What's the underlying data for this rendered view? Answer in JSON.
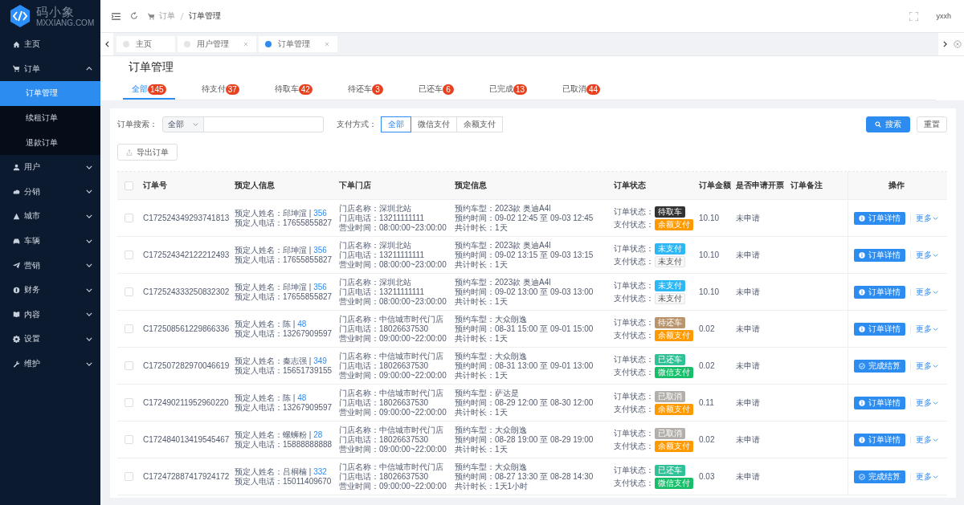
{
  "logo": {
    "name": "码小象",
    "domain": "MXXIANG.COM"
  },
  "sidebar": {
    "items": [
      {
        "label": "主页",
        "kind": "link"
      },
      {
        "label": "订单",
        "kind": "group",
        "expanded": true,
        "children": [
          {
            "label": "订单管理",
            "selected": true
          },
          {
            "label": "续租订单",
            "selected": false
          },
          {
            "label": "退款订单",
            "selected": false
          }
        ]
      },
      {
        "label": "用户",
        "kind": "group",
        "expanded": false
      },
      {
        "label": "分销",
        "kind": "group",
        "expanded": false
      },
      {
        "label": "城市",
        "kind": "group",
        "expanded": false
      },
      {
        "label": "车辆",
        "kind": "group",
        "expanded": false
      },
      {
        "label": "营销",
        "kind": "group",
        "expanded": false
      },
      {
        "label": "财务",
        "kind": "group",
        "expanded": false
      },
      {
        "label": "内容",
        "kind": "group",
        "expanded": false
      },
      {
        "label": "设置",
        "kind": "group",
        "expanded": false
      },
      {
        "label": "维护",
        "kind": "group",
        "expanded": false
      }
    ]
  },
  "header": {
    "breadcrumb": [
      "订单",
      "订单管理"
    ],
    "user": "yxxh"
  },
  "tag_bar": [
    {
      "label": "主页",
      "selected": false,
      "closable": false
    },
    {
      "label": "用户管理",
      "selected": false,
      "closable": true
    },
    {
      "label": "订单管理",
      "selected": true,
      "closable": true
    }
  ],
  "page_title": "订单管理",
  "tabs": [
    {
      "label": "全部",
      "count": "145",
      "selected": true
    },
    {
      "label": "待支付",
      "count": "37",
      "selected": false
    },
    {
      "label": "待取车",
      "count": "42",
      "selected": false
    },
    {
      "label": "待还车",
      "count": "3",
      "selected": false
    },
    {
      "label": "已还车",
      "count": "6",
      "selected": false
    },
    {
      "label": "已完成",
      "count": "13",
      "selected": false
    },
    {
      "label": "已取消",
      "count": "44",
      "selected": false
    }
  ],
  "filters": {
    "search_label": "订单搜索：",
    "search_type": "全部",
    "payment_label": "支付方式：",
    "payment_options": [
      {
        "label": "全部",
        "selected": true
      },
      {
        "label": "微信支付",
        "selected": false
      },
      {
        "label": "余额支付",
        "selected": false
      }
    ],
    "search_button": "搜索",
    "reset_button": "重置",
    "export_button": "导出订单"
  },
  "table": {
    "select_all": false,
    "columns": [
      "订单号",
      "预定人信息",
      "下单门店",
      "预定信息",
      "订单状态",
      "订单金额",
      "是否申请开票",
      "订单备注",
      "操作"
    ],
    "rows": [
      {
        "selected": false,
        "order_no": "C172524349293741813",
        "person": {
          "name": "预定人姓名：邱坤渲 |",
          "id": "356",
          "phone": "预定人电话：17655855827"
        },
        "store": [
          "门店名称：深圳北站",
          "门店电话：13211111111",
          "营业时间：08:00:00~23:00:00"
        ],
        "booking": [
          "预约车型：2023款 奥迪A4l",
          "预约时间：09-02 12:45 至 09-03 12:45",
          "共计时长：1天"
        ],
        "status": [
          {
            "label": "订单状态：",
            "text": "待取车",
            "kind": "pickup"
          },
          {
            "label": "支付状态：",
            "text": "余额支付",
            "kind": "balance"
          }
        ],
        "amount": "10.10",
        "invoice": "未申请",
        "action": {
          "label": "订单详情",
          "kind": "detail"
        },
        "more": "更多"
      },
      {
        "selected": false,
        "order_no": "C172524342122212493",
        "person": {
          "name": "预定人姓名：邱坤渲 |",
          "id": "356",
          "phone": "预定人电话：17655855827"
        },
        "store": [
          "门店名称：深圳北站",
          "门店电话：13211111111",
          "营业时间：08:00:00~23:00:00"
        ],
        "booking": [
          "预约车型：2023款 奥迪A4l",
          "预约时间：09-02 13:15 至 09-03 13:15",
          "共计时长：1天"
        ],
        "status": [
          {
            "label": "订单状态：",
            "text": "未支付",
            "kind": "unpaid"
          },
          {
            "label": "支付状态：",
            "text": "未支付",
            "kind": "none"
          }
        ],
        "amount": "10.10",
        "invoice": "未申请",
        "action": {
          "label": "订单详情",
          "kind": "detail"
        },
        "more": "更多"
      },
      {
        "selected": false,
        "order_no": "C172524333250832302",
        "person": {
          "name": "预定人姓名：邱坤渲 |",
          "id": "356",
          "phone": "预定人电话：17655855827"
        },
        "store": [
          "门店名称：深圳北站",
          "门店电话：13211111111",
          "营业时间：08:00:00~23:00:00"
        ],
        "booking": [
          "预约车型：2023款 奥迪A4l",
          "预约时间：09-02 13:00 至 09-03 13:00",
          "共计时长：1天"
        ],
        "status": [
          {
            "label": "订单状态：",
            "text": "未支付",
            "kind": "unpaid"
          },
          {
            "label": "支付状态：",
            "text": "未支付",
            "kind": "none"
          }
        ],
        "amount": "10.10",
        "invoice": "未申请",
        "action": {
          "label": "订单详情",
          "kind": "detail"
        },
        "more": "更多"
      },
      {
        "selected": false,
        "order_no": "C172508561229866336",
        "person": {
          "name": "预定人姓名：陈 |",
          "id": "48",
          "phone": "预定人电话：13267909597"
        },
        "store": [
          "门店名称：中信城市时代门店",
          "门店电话：18026637530",
          "营业时间：09:00:00~22:00:00"
        ],
        "booking": [
          "预约车型：大众朗逸",
          "预约时间：08-31 15:00 至 09-01 15:00",
          "共计时长：1天"
        ],
        "status": [
          {
            "label": "订单状态：",
            "text": "待还车",
            "kind": "returning"
          },
          {
            "label": "支付状态：",
            "text": "余额支付",
            "kind": "balance"
          }
        ],
        "amount": "0.02",
        "invoice": "未申请",
        "action": {
          "label": "订单详情",
          "kind": "detail"
        },
        "more": "更多"
      },
      {
        "selected": false,
        "order_no": "C172507282970046619",
        "person": {
          "name": "预定人姓名：秦志强 |",
          "id": "349",
          "phone": "预定人电话：15651739155"
        },
        "store": [
          "门店名称：中信城市时代门店",
          "门店电话：18026637530",
          "营业时间：09:00:00~22:00:00"
        ],
        "booking": [
          "预约车型：大众朗逸",
          "预约时间：08-31 13:00 至 09-01 13:00",
          "共计时长：1天"
        ],
        "status": [
          {
            "label": "订单状态：",
            "text": "已还车",
            "kind": "returned"
          },
          {
            "label": "支付状态：",
            "text": "微信支付",
            "kind": "wechat"
          }
        ],
        "amount": "0.02",
        "invoice": "未申请",
        "action": {
          "label": "完成结算",
          "kind": "settle"
        },
        "more": "更多"
      },
      {
        "selected": false,
        "order_no": "C172490211952960220",
        "person": {
          "name": "预定人姓名：陈 |",
          "id": "48",
          "phone": "预定人电话：13267909597"
        },
        "store": [
          "门店名称：中信城市时代门店",
          "门店电话：18026637530",
          "营业时间：09:00:00~22:00:00"
        ],
        "booking": [
          "预约车型：萨达是",
          "预约时间：08-29 12:00 至 08-30 12:00",
          "共计时长：1天"
        ],
        "status": [
          {
            "label": "订单状态：",
            "text": "已取消",
            "kind": "cancelled"
          },
          {
            "label": "支付状态：",
            "text": "余额支付",
            "kind": "balance"
          }
        ],
        "amount": "0.11",
        "invoice": "未申请",
        "action": {
          "label": "订单详情",
          "kind": "detail"
        },
        "more": "更多"
      },
      {
        "selected": false,
        "order_no": "C172484013419545467",
        "person": {
          "name": "预定人姓名：螺蛳粉 |",
          "id": "28",
          "phone": "预定人电话：15888888888"
        },
        "store": [
          "门店名称：中信城市时代门店",
          "门店电话：18026637530",
          "营业时间：09:00:00~22:00:00"
        ],
        "booking": [
          "预约车型：大众朗逸",
          "预约时间：08-28 19:00 至 08-29 19:00",
          "共计时长：1天"
        ],
        "status": [
          {
            "label": "订单状态：",
            "text": "已取消",
            "kind": "cancelled"
          },
          {
            "label": "支付状态：",
            "text": "余额支付",
            "kind": "balance"
          }
        ],
        "amount": "0.02",
        "invoice": "未申请",
        "action": {
          "label": "订单详情",
          "kind": "detail"
        },
        "more": "更多"
      },
      {
        "selected": false,
        "order_no": "C172472887417924172",
        "person": {
          "name": "预定人姓名：吕桐楠 |",
          "id": "332",
          "phone": "预定人电话：15011409670"
        },
        "store": [
          "门店名称：中信城市时代门店",
          "门店电话：18026637530",
          "营业时间：09:00:00~22:00:00"
        ],
        "booking": [
          "预约车型：大众朗逸",
          "预约时间：08-27 13:30 至 08-28 14:30",
          "共计时长：1天1小时"
        ],
        "status": [
          {
            "label": "订单状态：",
            "text": "已还车",
            "kind": "returned"
          },
          {
            "label": "支付状态：",
            "text": "微信支付",
            "kind": "wechat"
          }
        ],
        "amount": "0.03",
        "invoice": "未申请",
        "action": {
          "label": "完成结算",
          "kind": "settle"
        },
        "more": "更多"
      }
    ]
  }
}
